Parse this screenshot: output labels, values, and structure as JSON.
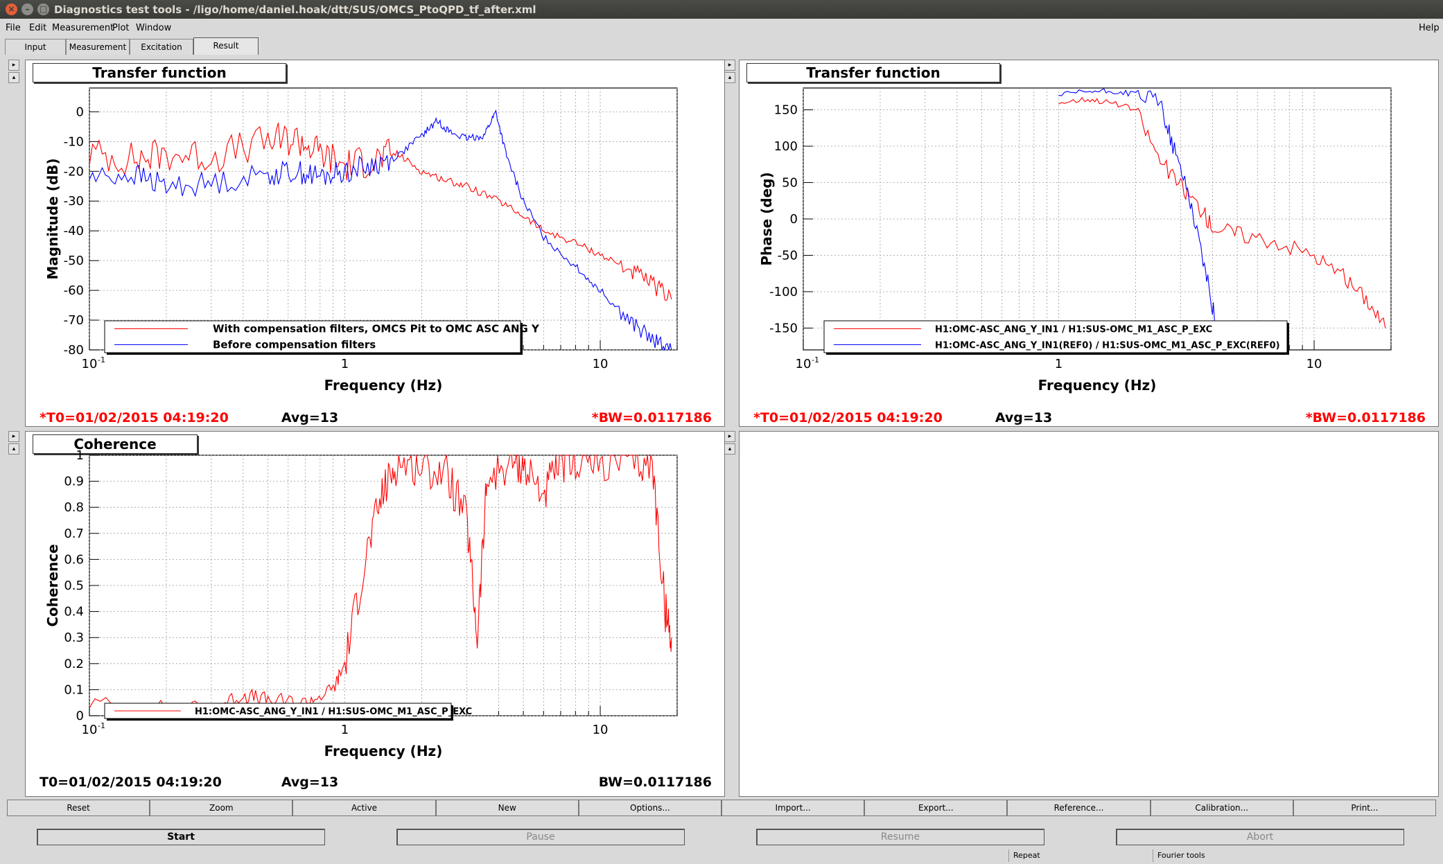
{
  "window": {
    "title": "Diagnostics test tools - /ligo/home/daniel.hoak/dtt/SUS/OMCS_PtoQPD_tf_after.xml"
  },
  "menu": [
    "File",
    "Edit",
    "Measurement",
    "Plot",
    "Window"
  ],
  "help": "Help",
  "tabs": [
    "Input",
    "Measurement",
    "Excitation",
    "Result"
  ],
  "plots": {
    "mag": {
      "panel_title": "Transfer function",
      "ylabel": "Magnitude (dB)",
      "xlabel": "Frequency (Hz)",
      "yticks": [
        "0",
        "-10",
        "-20",
        "-30",
        "-40",
        "-50",
        "-60",
        "-70",
        "-80"
      ],
      "xticks": [
        "10",
        "1",
        "10"
      ],
      "xtick_exp": "-1",
      "legend": [
        "With compensation filters, OMCS Pit to OMC ASC ANG Y",
        "Before compensation filters"
      ],
      "t0": "*T0=01/02/2015 04:19:20",
      "avg": "Avg=13",
      "bw": "*BW=0.0117186"
    },
    "phase": {
      "panel_title": "Transfer function",
      "ylabel": "Phase (deg)",
      "xlabel": "Frequency (Hz)",
      "yticks": [
        "150",
        "100",
        "50",
        "0",
        "-50",
        "-100",
        "-150"
      ],
      "xticks": [
        "10",
        "1",
        "10"
      ],
      "xtick_exp": "-1",
      "legend": [
        "H1:OMC-ASC_ANG_Y_IN1 / H1:SUS-OMC_M1_ASC_P_EXC",
        "H1:OMC-ASC_ANG_Y_IN1(REF0) / H1:SUS-OMC_M1_ASC_P_EXC(REF0)"
      ],
      "t0": "*T0=01/02/2015 04:19:20",
      "avg": "Avg=13",
      "bw": "*BW=0.0117186"
    },
    "coh": {
      "panel_title": "Coherence",
      "ylabel": "Coherence",
      "xlabel": "Frequency (Hz)",
      "yticks": [
        "1",
        "0.9",
        "0.8",
        "0.7",
        "0.6",
        "0.5",
        "0.4",
        "0.3",
        "0.2",
        "0.1",
        "0"
      ],
      "xticks": [
        "10",
        "1",
        "10"
      ],
      "xtick_exp": "-1",
      "legend": [
        "H1:OMC-ASC_ANG_Y_IN1 / H1:SUS-OMC_M1_ASC_P_EXC"
      ],
      "t0": "T0=01/02/2015 04:19:20",
      "avg": "Avg=13",
      "bw": "BW=0.0117186"
    }
  },
  "plot_buttons": [
    "Reset",
    "Zoom",
    "Active",
    "New",
    "Options...",
    "Import...",
    "Export...",
    "Reference...",
    "Calibration...",
    "Print..."
  ],
  "controls": [
    "Start",
    "Pause",
    "Resume",
    "Abort"
  ],
  "status": [
    "Repeat",
    "Fourier tools"
  ],
  "chart_data": [
    {
      "type": "line",
      "xlabel": "Frequency (Hz)",
      "ylabel": "Magnitude (dB)",
      "xscale": "log",
      "xlim": [
        0.1,
        20
      ],
      "ylim": [
        -80,
        8
      ],
      "grid": true,
      "legend": "bottom-left",
      "series": [
        {
          "name": "With compensation filters, OMCS Pit to OMC ASC ANG Y",
          "color": "#ff0000",
          "x": [
            0.1,
            0.15,
            0.2,
            0.3,
            0.5,
            0.65,
            0.8,
            1.0,
            1.3,
            1.6,
            2.0,
            2.5,
            3.0,
            4.0,
            5.0,
            6.0,
            8.0,
            10,
            13,
            16,
            19
          ],
          "y": [
            -14,
            -16,
            -14,
            -15,
            -10,
            -9,
            -14,
            -18,
            -16,
            -14,
            -20,
            -23,
            -25,
            -30,
            -35,
            -40,
            -44,
            -48,
            -53,
            -58,
            -63
          ]
        },
        {
          "name": "Before compensation filters",
          "color": "#0000ff",
          "x": [
            0.1,
            0.15,
            0.2,
            0.3,
            0.5,
            0.65,
            0.8,
            1.0,
            1.3,
            1.6,
            2.0,
            2.3,
            2.6,
            3.0,
            3.5,
            3.9,
            4.3,
            5.0,
            6.0,
            8.0,
            10,
            13,
            16,
            19
          ],
          "y": [
            -22,
            -21,
            -25,
            -24,
            -21,
            -20,
            -22,
            -20,
            -18,
            -15,
            -8,
            -3,
            -7,
            -9,
            -8,
            0,
            -15,
            -30,
            -42,
            -52,
            -60,
            -70,
            -77,
            -80
          ]
        }
      ]
    },
    {
      "type": "line",
      "xlabel": "Frequency (Hz)",
      "ylabel": "Phase (deg)",
      "xscale": "log",
      "xlim": [
        0.1,
        20
      ],
      "ylim": [
        -180,
        180
      ],
      "grid": true,
      "legend": "bottom-right",
      "series": [
        {
          "name": "H1:OMC-ASC_ANG_Y_IN1 / H1:SUS-OMC_M1_ASC_P_EXC",
          "color": "#ff0000",
          "x": [
            1.0,
            1.3,
            1.6,
            2.0,
            2.5,
            3.0,
            3.5,
            4.0,
            5.0,
            7.0,
            10,
            13,
            16,
            19
          ],
          "y": [
            160,
            165,
            160,
            150,
            80,
            45,
            20,
            -10,
            -20,
            -30,
            -50,
            -80,
            -110,
            -150
          ]
        },
        {
          "name": "H1:OMC-ASC_ANG_Y_IN1(REF0) / H1:SUS-OMC_M1_ASC_P_EXC(REF0)",
          "color": "#0000ff",
          "x": [
            1.0,
            1.3,
            1.6,
            2.0,
            2.5,
            2.8,
            3.2,
            3.6,
            4.0,
            4.3
          ],
          "y": [
            170,
            175,
            175,
            172,
            160,
            100,
            40,
            -40,
            -120,
            -180
          ]
        }
      ]
    },
    {
      "type": "line",
      "xlabel": "Frequency (Hz)",
      "ylabel": "Coherence",
      "xscale": "log",
      "xlim": [
        0.1,
        20
      ],
      "ylim": [
        0,
        1
      ],
      "grid": true,
      "legend": "bottom-left",
      "series": [
        {
          "name": "H1:OMC-ASC_ANG_Y_IN1 / H1:SUS-OMC_M1_ASC_P_EXC",
          "color": "#ff0000",
          "x": [
            0.1,
            0.2,
            0.3,
            0.4,
            0.5,
            0.7,
            0.9,
            1.0,
            1.2,
            1.4,
            1.6,
            2.0,
            2.5,
            3.0,
            3.3,
            3.6,
            4.5,
            5.0,
            6.0,
            7.0,
            8.0,
            10,
            13,
            16,
            18,
            19
          ],
          "y": [
            0.05,
            0.03,
            0.03,
            0.08,
            0.06,
            0.05,
            0.1,
            0.2,
            0.6,
            0.85,
            0.97,
            0.96,
            0.93,
            0.75,
            0.3,
            0.9,
            0.98,
            0.96,
            0.85,
            0.97,
            0.98,
            0.97,
            0.98,
            0.96,
            0.4,
            0.3
          ]
        }
      ]
    }
  ]
}
